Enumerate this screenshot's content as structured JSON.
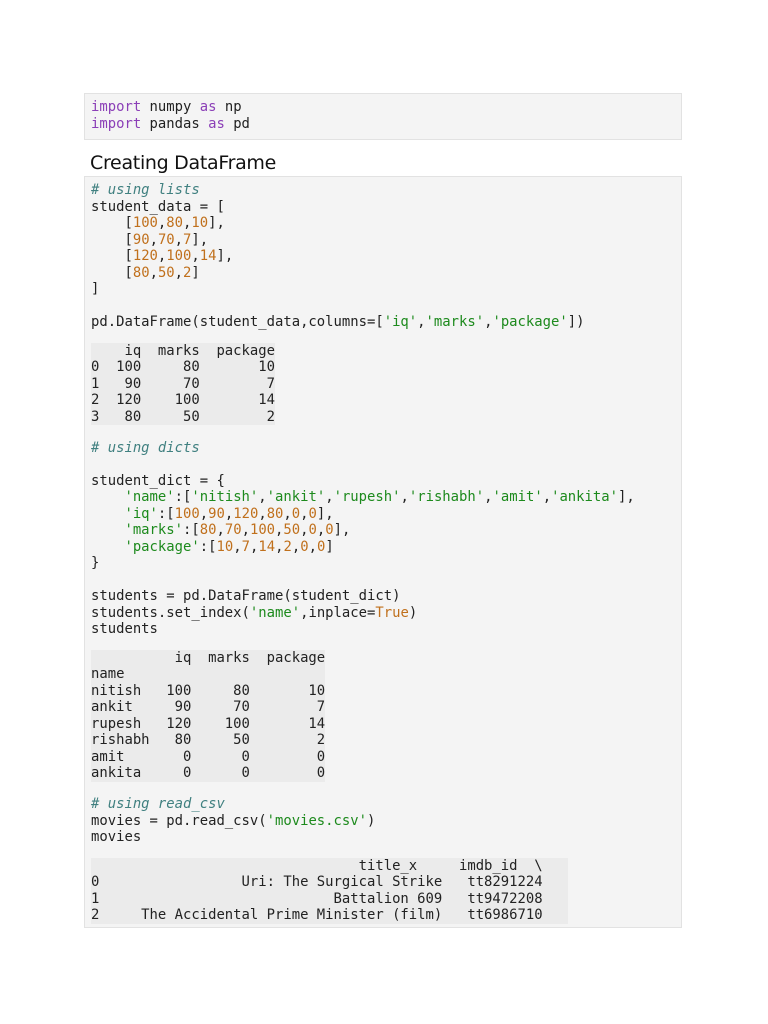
{
  "cell1": {
    "lines": [
      [
        [
          "kw",
          "import"
        ],
        [
          "t",
          " numpy "
        ],
        [
          "kw",
          "as"
        ],
        [
          "t",
          " np"
        ]
      ],
      [
        [
          "kw",
          "import"
        ],
        [
          "t",
          " pandas "
        ],
        [
          "kw",
          "as"
        ],
        [
          "t",
          " pd"
        ]
      ]
    ]
  },
  "heading": "Creating DataFrame",
  "cell2": {
    "blocks": [
      {
        "type": "code",
        "lines": [
          [
            [
              "com",
              "# using lists"
            ]
          ],
          [
            [
              "t",
              "student_data = ["
            ]
          ],
          [
            [
              "t",
              "    ["
            ],
            [
              "num",
              "100"
            ],
            [
              "t",
              ","
            ],
            [
              "num",
              "80"
            ],
            [
              "t",
              ","
            ],
            [
              "num",
              "10"
            ],
            [
              "t",
              "],"
            ]
          ],
          [
            [
              "t",
              "    ["
            ],
            [
              "num",
              "90"
            ],
            [
              "t",
              ","
            ],
            [
              "num",
              "70"
            ],
            [
              "t",
              ","
            ],
            [
              "num",
              "7"
            ],
            [
              "t",
              "],"
            ]
          ],
          [
            [
              "t",
              "    ["
            ],
            [
              "num",
              "120"
            ],
            [
              "t",
              ","
            ],
            [
              "num",
              "100"
            ],
            [
              "t",
              ","
            ],
            [
              "num",
              "14"
            ],
            [
              "t",
              "],"
            ]
          ],
          [
            [
              "t",
              "    ["
            ],
            [
              "num",
              "80"
            ],
            [
              "t",
              ","
            ],
            [
              "num",
              "50"
            ],
            [
              "t",
              ","
            ],
            [
              "num",
              "2"
            ],
            [
              "t",
              "]"
            ]
          ],
          [
            [
              "t",
              "]"
            ]
          ],
          [
            [
              "t",
              ""
            ]
          ],
          [
            [
              "t",
              "pd.DataFrame(student_data,columns=["
            ],
            [
              "str",
              "'iq'"
            ],
            [
              "t",
              ","
            ],
            [
              "str",
              "'marks'"
            ],
            [
              "t",
              ","
            ],
            [
              "str",
              "'package'"
            ],
            [
              "t",
              "])"
            ]
          ]
        ]
      },
      {
        "type": "output",
        "lines": [
          "    iq  marks  package",
          "0  100     80       10",
          "1   90     70        7",
          "2  120    100       14",
          "3   80     50        2"
        ]
      },
      {
        "type": "code",
        "lines": [
          [
            [
              "com",
              "# using dicts"
            ]
          ],
          [
            [
              "t",
              ""
            ]
          ],
          [
            [
              "t",
              "student_dict = {"
            ]
          ],
          [
            [
              "t",
              "    "
            ],
            [
              "str",
              "'name'"
            ],
            [
              "t",
              ":["
            ],
            [
              "str",
              "'nitish'"
            ],
            [
              "t",
              ","
            ],
            [
              "str",
              "'ankit'"
            ],
            [
              "t",
              ","
            ],
            [
              "str",
              "'rupesh'"
            ],
            [
              "t",
              ","
            ],
            [
              "str",
              "'rishabh'"
            ],
            [
              "t",
              ","
            ],
            [
              "str",
              "'amit'"
            ],
            [
              "t",
              ","
            ],
            [
              "str",
              "'ankita'"
            ],
            [
              "t",
              "],"
            ]
          ],
          [
            [
              "t",
              "    "
            ],
            [
              "str",
              "'iq'"
            ],
            [
              "t",
              ":["
            ],
            [
              "num",
              "100"
            ],
            [
              "t",
              ","
            ],
            [
              "num",
              "90"
            ],
            [
              "t",
              ","
            ],
            [
              "num",
              "120"
            ],
            [
              "t",
              ","
            ],
            [
              "num",
              "80"
            ],
            [
              "t",
              ","
            ],
            [
              "num",
              "0"
            ],
            [
              "t",
              ","
            ],
            [
              "num",
              "0"
            ],
            [
              "t",
              "],"
            ]
          ],
          [
            [
              "t",
              "    "
            ],
            [
              "str",
              "'marks'"
            ],
            [
              "t",
              ":["
            ],
            [
              "num",
              "80"
            ],
            [
              "t",
              ","
            ],
            [
              "num",
              "70"
            ],
            [
              "t",
              ","
            ],
            [
              "num",
              "100"
            ],
            [
              "t",
              ","
            ],
            [
              "num",
              "50"
            ],
            [
              "t",
              ","
            ],
            [
              "num",
              "0"
            ],
            [
              "t",
              ","
            ],
            [
              "num",
              "0"
            ],
            [
              "t",
              "],"
            ]
          ],
          [
            [
              "t",
              "    "
            ],
            [
              "str",
              "'package'"
            ],
            [
              "t",
              ":["
            ],
            [
              "num",
              "10"
            ],
            [
              "t",
              ","
            ],
            [
              "num",
              "7"
            ],
            [
              "t",
              ","
            ],
            [
              "num",
              "14"
            ],
            [
              "t",
              ","
            ],
            [
              "num",
              "2"
            ],
            [
              "t",
              ","
            ],
            [
              "num",
              "0"
            ],
            [
              "t",
              ","
            ],
            [
              "num",
              "0"
            ],
            [
              "t",
              "]"
            ]
          ],
          [
            [
              "t",
              "}"
            ]
          ],
          [
            [
              "t",
              ""
            ]
          ],
          [
            [
              "t",
              "students = pd.DataFrame(student_dict)"
            ]
          ],
          [
            [
              "t",
              "students.set_index("
            ],
            [
              "str",
              "'name'"
            ],
            [
              "t",
              ",inplace="
            ],
            [
              "const",
              "True"
            ],
            [
              "t",
              ")"
            ]
          ],
          [
            [
              "t",
              "students"
            ]
          ]
        ]
      },
      {
        "type": "output",
        "lines": [
          "          iq  marks  package",
          "name                        ",
          "nitish   100     80       10",
          "ankit     90     70        7",
          "rupesh   120    100       14",
          "rishabh   80     50        2",
          "amit       0      0        0",
          "ankita     0      0        0"
        ]
      },
      {
        "type": "code",
        "lines": [
          [
            [
              "com",
              "# using read_csv"
            ]
          ],
          [
            [
              "t",
              "movies = pd.read_csv("
            ],
            [
              "str",
              "'movies.csv'"
            ],
            [
              "t",
              ")"
            ]
          ],
          [
            [
              "t",
              "movies"
            ]
          ]
        ]
      },
      {
        "type": "output",
        "lines": [
          "                                title_x     imdb_id  \\",
          "0                 Uri: The Surgical Strike   tt8291224   ",
          "1                            Battalion 609   tt9472208   ",
          "2     The Accidental Prime Minister (film)   tt6986710   "
        ]
      }
    ]
  }
}
